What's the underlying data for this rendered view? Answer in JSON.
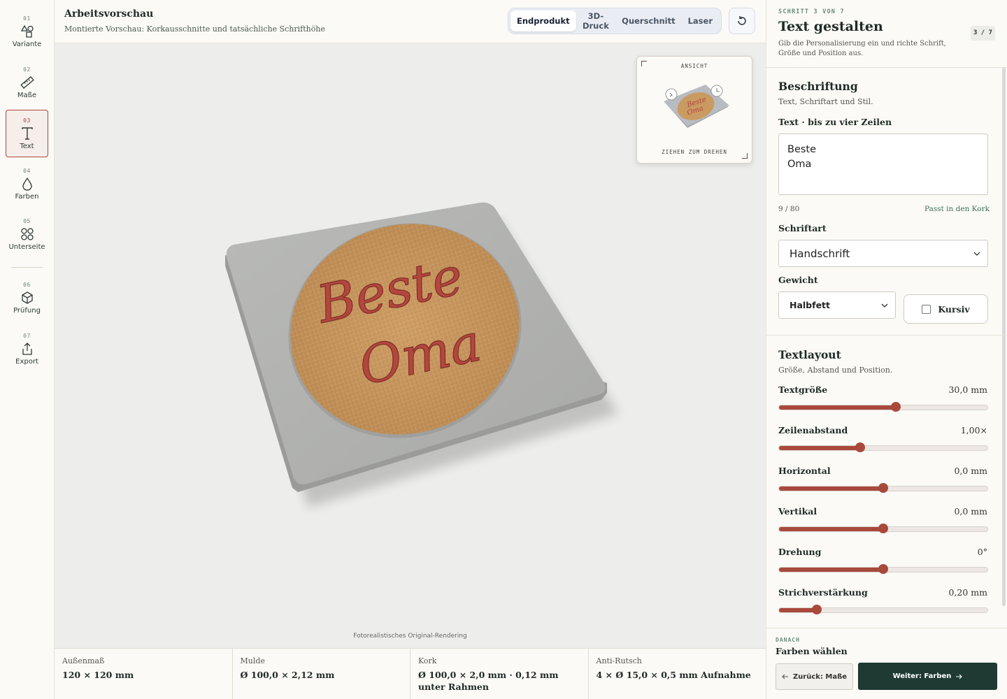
{
  "rail": {
    "steps": [
      {
        "num": "01",
        "label": "Variante",
        "icon": "shapes-icon"
      },
      {
        "num": "02",
        "label": "Maße",
        "icon": "ruler-icon"
      },
      {
        "num": "03",
        "label": "Text",
        "icon": "text-icon",
        "active": true
      },
      {
        "num": "04",
        "label": "Farben",
        "icon": "droplet-icon"
      },
      {
        "num": "05",
        "label": "Unterseite",
        "icon": "circles-icon"
      },
      {
        "num": "06",
        "label": "Prüfung",
        "icon": "cube-icon"
      },
      {
        "num": "07",
        "label": "Export",
        "icon": "share-icon"
      }
    ]
  },
  "header": {
    "title": "Arbeitsvorschau",
    "subtitle": "Montierte Vorschau: Korkausschnitte und tatsächliche Schrifthöhe",
    "tabs": [
      "Endprodukt",
      "3D-Druck",
      "Querschnitt",
      "Laser"
    ],
    "active_tab": "Endprodukt"
  },
  "viewport": {
    "caption": "Fotorealistisches Original-Rendering",
    "coaster_text": [
      "Beste",
      "Oma"
    ],
    "minimap": {
      "top": "ANSICHT",
      "bottom": "ZIEHEN ZUM DREHEN"
    }
  },
  "specs": [
    {
      "label": "Außenmaß",
      "value": "120 × 120 mm"
    },
    {
      "label": "Mulde",
      "value": "Ø 100,0 × 2,12 mm"
    },
    {
      "label": "Kork",
      "value": "Ø 100,0 × 2,0 mm · 0,12 mm unter Rahmen"
    },
    {
      "label": "Anti-Rutsch",
      "value": "4 × Ø 15,0 × 0,5 mm Aufnahme"
    }
  ],
  "panel": {
    "eyebrow": "SCHRITT 3 VON 7",
    "title": "Text gestalten",
    "description": "Gib die Personalisierung ein und richte Schrift, Größe und Position aus.",
    "badge": "3 / 7",
    "inscription": {
      "heading": "Beschriftung",
      "subheading": "Text, Schriftart und Stil.",
      "text_label": "Text · bis zu vier Zeilen",
      "text_value": "Beste\nOma",
      "count": "9 / 80",
      "fits": "Passt in den Kork",
      "font_label": "Schriftart",
      "font_value": "Handschrift",
      "weight_label": "Gewicht",
      "weight_value": "Halbfett",
      "italic_label": "Kursiv",
      "italic_checked": false
    },
    "layout": {
      "heading": "Textlayout",
      "subheading": "Größe, Abstand und Position.",
      "sliders": [
        {
          "label": "Textgröße",
          "value": "30,0 mm",
          "level": 0.56
        },
        {
          "label": "Zeilenabstand",
          "value": "1,00×",
          "level": 0.39
        },
        {
          "label": "Horizontal",
          "value": "0,0 mm",
          "level": 0.5
        },
        {
          "label": "Vertikal",
          "value": "0,0 mm",
          "level": 0.5
        },
        {
          "label": "Drehung",
          "value": "0°",
          "level": 0.5
        },
        {
          "label": "Strichverstärkung",
          "value": "0,20 mm",
          "level": 0.18
        }
      ]
    },
    "footer": {
      "next_caption": "DANACH",
      "next_title": "Farben wählen",
      "back_label": "Zurück: Maße",
      "next_label": "Weiter: Farben"
    }
  },
  "colors": {
    "accent": "#a8493c",
    "primary": "#1e3a32",
    "cork": "#c99a62"
  }
}
